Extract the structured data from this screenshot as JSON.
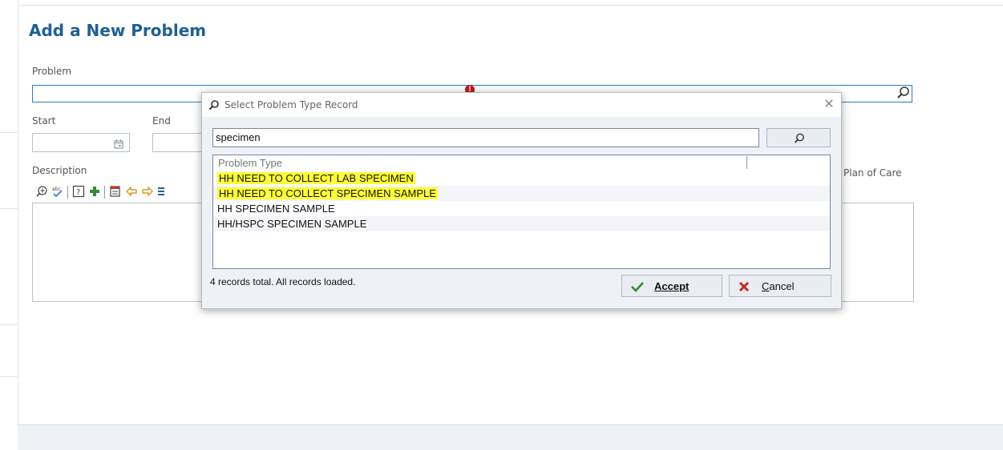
{
  "page": {
    "title": "Add a New Problem",
    "problem_label": "Problem",
    "start_label": "Start",
    "end_label": "End",
    "description_label": "Description",
    "plan_of_care_label": "Plan of Care",
    "problem_value": "",
    "start_value": "",
    "end_value": ""
  },
  "dialog": {
    "title": "Select Problem Type Record",
    "search_value": "specimen",
    "column_header": "Problem Type",
    "rows": [
      "HH NEED TO COLLECT LAB SPECIMEN",
      "HH NEED TO COLLECT SPECIMEN SAMPLE",
      "HH SPECIMEN SAMPLE",
      "HH/HSPC SPECIMEN SAMPLE"
    ],
    "status": "4 records total. All records loaded.",
    "accept_label": "Accept",
    "cancel_label": "Cancel"
  },
  "colors": {
    "title_blue": "#1f5f93",
    "highlight_yellow": "#ffff33",
    "required_red": "#c0181f",
    "accept_green": "#2e8b3a",
    "cancel_red": "#c62828"
  },
  "icons": {
    "title_icon": "magnifier-icon",
    "problem_search": "magnifier-icon",
    "required": "exclamation-icon",
    "start_picker": "calendar-icon",
    "search_button": "magnifier-icon",
    "accept": "checkmark-icon",
    "cancel": "x-icon"
  }
}
